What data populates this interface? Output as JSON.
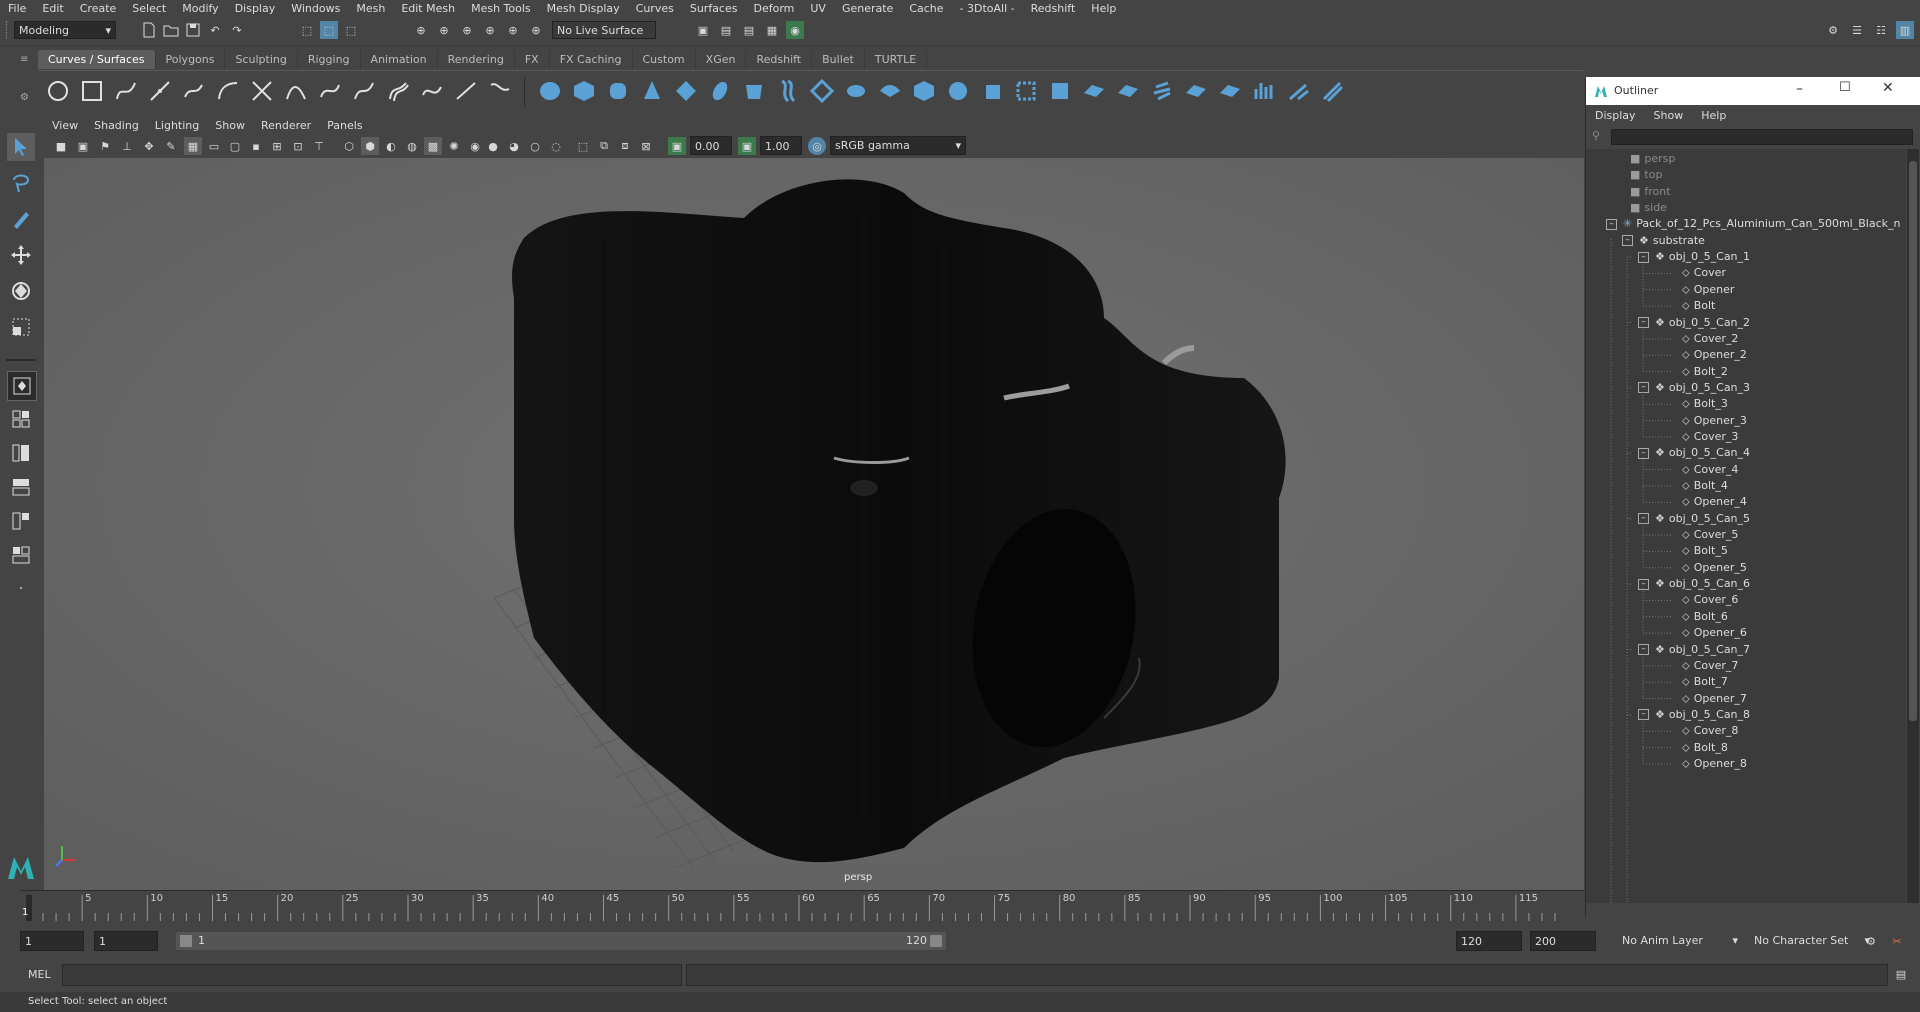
{
  "menubar": [
    "File",
    "Edit",
    "Create",
    "Select",
    "Modify",
    "Display",
    "Windows",
    "Mesh",
    "Edit Mesh",
    "Mesh Tools",
    "Mesh Display",
    "Curves",
    "Surfaces",
    "Deform",
    "UV",
    "Generate",
    "Cache",
    "- 3DtoAll -",
    "Redshift",
    "Help"
  ],
  "statusline": {
    "mode": "Modeling",
    "live_surface": "No Live Surface"
  },
  "shelf_tabs": [
    "Curves / Surfaces",
    "Polygons",
    "Sculpting",
    "Rigging",
    "Animation",
    "Rendering",
    "FX",
    "FX Caching",
    "Custom",
    "XGen",
    "Redshift",
    "Bullet",
    "TURTLE"
  ],
  "panel_menu": [
    "View",
    "Shading",
    "Lighting",
    "Show",
    "Renderer",
    "Panels"
  ],
  "viewport_toolbar": {
    "exposure": "0.00",
    "gamma": "1.00",
    "color_space": "sRGB gamma"
  },
  "viewport": {
    "camera_label": "persp"
  },
  "outliner": {
    "title": "Outliner",
    "menu": [
      "Display",
      "Show",
      "Help"
    ],
    "cameras": [
      "persp",
      "top",
      "front",
      "side"
    ],
    "root": "Pack_of_12_Pcs_Aluminium_Can_500ml_Black_n",
    "group": "substrate",
    "cans": [
      {
        "name": "obj_0_5_Can_1",
        "children": [
          "Cover",
          "Opener",
          "Bolt"
        ]
      },
      {
        "name": "obj_0_5_Can_2",
        "children": [
          "Cover_2",
          "Opener_2",
          "Bolt_2"
        ]
      },
      {
        "name": "obj_0_5_Can_3",
        "children": [
          "Bolt_3",
          "Opener_3",
          "Cover_3"
        ]
      },
      {
        "name": "obj_0_5_Can_4",
        "children": [
          "Cover_4",
          "Bolt_4",
          "Opener_4"
        ]
      },
      {
        "name": "obj_0_5_Can_5",
        "children": [
          "Cover_5",
          "Bolt_5",
          "Opener_5"
        ]
      },
      {
        "name": "obj_0_5_Can_6",
        "children": [
          "Cover_6",
          "Bolt_6",
          "Opener_6"
        ]
      },
      {
        "name": "obj_0_5_Can_7",
        "children": [
          "Cover_7",
          "Bolt_7",
          "Opener_7"
        ]
      },
      {
        "name": "obj_0_5_Can_8",
        "children": [
          "Cover_8",
          "Bolt_8",
          "Opener_8"
        ]
      }
    ]
  },
  "timeline": {
    "ticks": [
      "5",
      "10",
      "15",
      "20",
      "25",
      "30",
      "35",
      "40",
      "45",
      "50",
      "55",
      "60",
      "65",
      "70",
      "75",
      "80",
      "85",
      "90",
      "95",
      "100",
      "105",
      "110",
      "115"
    ],
    "current": "1"
  },
  "range": {
    "start": "1",
    "playback_start": "1",
    "slider_start": "1",
    "slider_end": "120",
    "playback_end": "120",
    "end": "200",
    "anim_layer": "No Anim Layer",
    "character_set": "No Character Set"
  },
  "cmdline": {
    "lang": "MEL"
  },
  "helpline": {
    "text": "Select Tool: select an object"
  },
  "colors": {
    "accent": "#5285a6",
    "panel": "#444444",
    "viewport": "#6b6b6b",
    "field": "#2b2b2b"
  }
}
